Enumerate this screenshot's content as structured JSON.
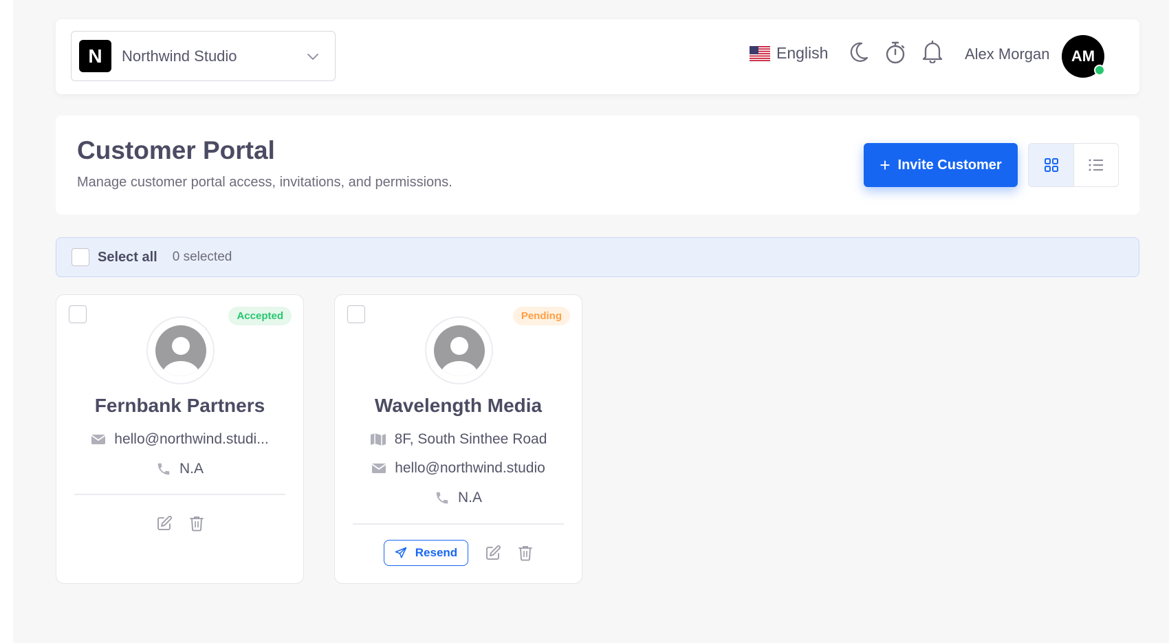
{
  "header": {
    "workspace": {
      "logo_letter": "N",
      "name": "Northwind Studio"
    },
    "language": "English",
    "user": {
      "name": "Alex Morgan",
      "initials": "AM"
    }
  },
  "page": {
    "title": "Customer Portal",
    "subtitle": "Manage customer portal access, invitations, and permissions.",
    "invite_button": "Invite Customer"
  },
  "selection": {
    "select_all_label": "Select all",
    "selected_count": "0 selected"
  },
  "customers": [
    {
      "name": "Fernbank Partners",
      "status": "Accepted",
      "email": "hello@northwind.studi...",
      "phone": "N.A"
    },
    {
      "name": "Wavelength Media",
      "status": "Pending",
      "address": "8F, South Sinthee Road",
      "email": "hello@northwind.studio",
      "phone": "N.A",
      "resend_label": "Resend"
    }
  ],
  "colors": {
    "primary": "#1766f2",
    "accepted": "#28c76f",
    "pending": "#ff9f43",
    "online": "#28c76f"
  }
}
